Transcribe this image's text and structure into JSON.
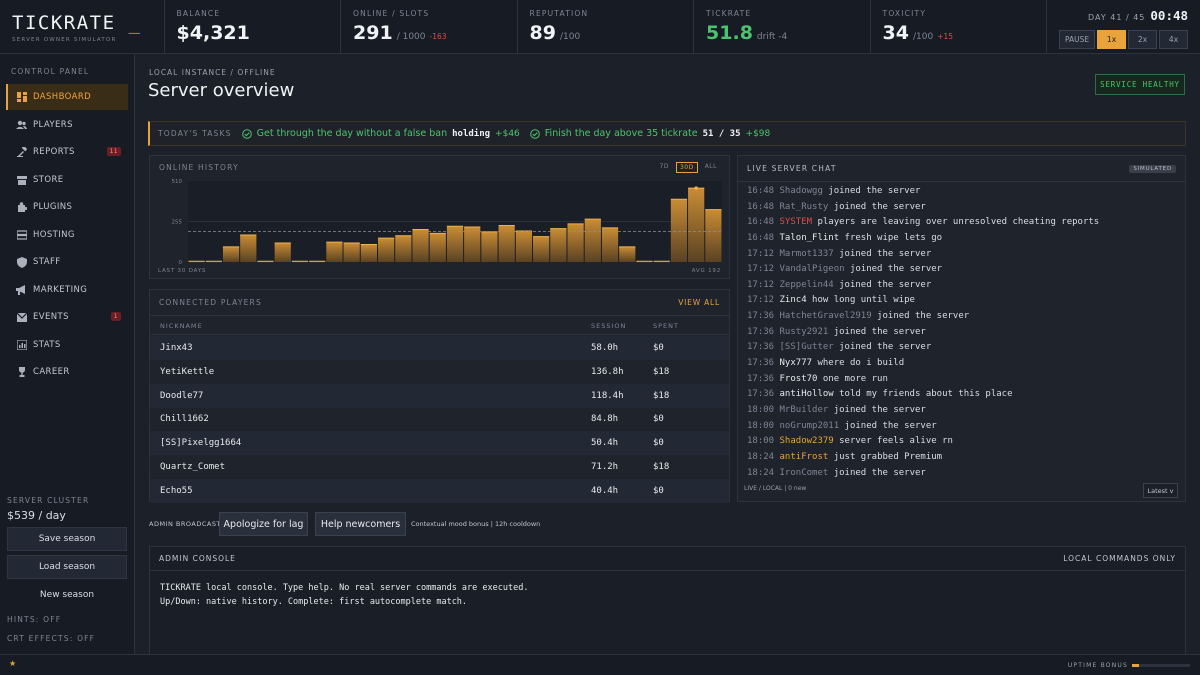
{
  "brand": {
    "name": "TICKRATE",
    "cursor": "_",
    "subtitle": "SERVER OWNER SIMULATOR"
  },
  "stats": {
    "balance": {
      "label": "BALANCE",
      "value": "$4,321"
    },
    "online": {
      "label": "ONLINE / SLOTS",
      "value": "291",
      "slots": "/ 1000",
      "delta": "-163"
    },
    "reputation": {
      "label": "REPUTATION",
      "value": "89",
      "max": "/100"
    },
    "tickrate": {
      "label": "TICKRATE",
      "value": "51.8",
      "drift": "drift -4"
    },
    "toxicity": {
      "label": "TOXICITY",
      "value": "34",
      "max": "/100",
      "delta": "+15"
    }
  },
  "time": {
    "day": "DAY 41 / 45",
    "clock": "00:48"
  },
  "speeds": [
    {
      "label": "PAUSE",
      "active": false
    },
    {
      "label": "1x",
      "active": true
    },
    {
      "label": "2x",
      "active": false
    },
    {
      "label": "4x",
      "active": false
    }
  ],
  "sidebar": {
    "section": "CONTROL PANEL",
    "items": [
      {
        "label": "DASHBOARD",
        "icon": "dashboard-icon",
        "active": true,
        "badge": ""
      },
      {
        "label": "PLAYERS",
        "icon": "players-icon",
        "active": false,
        "badge": ""
      },
      {
        "label": "REPORTS",
        "icon": "reports-icon",
        "active": false,
        "badge": "11"
      },
      {
        "label": "STORE",
        "icon": "store-icon",
        "active": false,
        "badge": ""
      },
      {
        "label": "PLUGINS",
        "icon": "plugins-icon",
        "active": false,
        "badge": ""
      },
      {
        "label": "HOSTING",
        "icon": "hosting-icon",
        "active": false,
        "badge": ""
      },
      {
        "label": "STAFF",
        "icon": "staff-icon",
        "active": false,
        "badge": ""
      },
      {
        "label": "MARKETING",
        "icon": "marketing-icon",
        "active": false,
        "badge": ""
      },
      {
        "label": "EVENTS",
        "icon": "events-icon",
        "active": false,
        "badge": "1"
      },
      {
        "label": "STATS",
        "icon": "stats-icon",
        "active": false,
        "badge": ""
      },
      {
        "label": "CAREER",
        "icon": "career-icon",
        "active": false,
        "badge": ""
      }
    ],
    "cluster": {
      "label": "SERVER CLUSTER",
      "price": "$539 / day",
      "save": "Save season",
      "load": "Load season",
      "new": "New season"
    },
    "hints": "HINTS: OFF",
    "crt": "CRT EFFECTS: OFF"
  },
  "main": {
    "crumb": "LOCAL INSTANCE / OFFLINE",
    "title": "Server overview",
    "health": "SERVICE HEALTHY"
  },
  "tasks": {
    "label": "TODAY'S TASKS",
    "items": [
      {
        "text": "Get through the day without a false ban",
        "status": "holding",
        "reward": "+$46"
      },
      {
        "text": "Finish the day above 35 tickrate",
        "status": "51 / 35",
        "reward": "+$98"
      }
    ]
  },
  "history": {
    "title": "ONLINE HISTORY",
    "ranges": [
      {
        "label": "7D",
        "active": false
      },
      {
        "label": "30D",
        "active": true
      },
      {
        "label": "ALL",
        "active": false
      }
    ],
    "foot_left": "LAST 30 DAYS",
    "foot_right": "AVG 192"
  },
  "chart_data": {
    "type": "bar",
    "ylim": [
      0,
      510
    ],
    "yticks": [
      "510",
      "255",
      "0"
    ],
    "values": [
      5,
      5,
      95,
      170,
      5,
      120,
      5,
      5,
      125,
      120,
      110,
      150,
      165,
      205,
      180,
      225,
      220,
      190,
      230,
      195,
      160,
      210,
      240,
      270,
      215,
      95,
      5,
      5,
      395,
      465,
      330
    ],
    "avg": 192,
    "marked_index": 29
  },
  "players": {
    "title": "CONNECTED PLAYERS",
    "view_all": "VIEW ALL",
    "columns": [
      "NICKNAME",
      "SESSION",
      "SPENT"
    ],
    "rows": [
      {
        "nick": "Jinx43",
        "session": "58.0h",
        "spent": "$0"
      },
      {
        "nick": "YetiKettle",
        "session": "136.8h",
        "spent": "$18"
      },
      {
        "nick": "Doodle77",
        "session": "118.4h",
        "spent": "$18"
      },
      {
        "nick": "Chill1662",
        "session": "84.8h",
        "spent": "$0"
      },
      {
        "nick": "[SS]Pixelgg1664",
        "session": "50.4h",
        "spent": "$0"
      },
      {
        "nick": "Quartz_Comet",
        "session": "71.2h",
        "spent": "$18"
      },
      {
        "nick": "Echo55",
        "session": "40.4h",
        "spent": "$0"
      }
    ]
  },
  "chat": {
    "title": "LIVE SERVER CHAT",
    "badge": "SIMULATED",
    "footer": "LIVE / LOCAL | 0 new",
    "latest": "Latest v",
    "lines": [
      {
        "time": "16:48",
        "user": "Shadowgg",
        "msg": "joined the server",
        "style": ""
      },
      {
        "time": "16:48",
        "user": "Rat_Rusty",
        "msg": "joined the server",
        "style": ""
      },
      {
        "time": "16:48",
        "user": "SYSTEM",
        "msg": "players are leaving over unresolved cheating reports",
        "style": "sys"
      },
      {
        "time": "16:48",
        "user": "Talon_Flint",
        "msg": "fresh wipe lets go",
        "style": "bright"
      },
      {
        "time": "17:12",
        "user": "Marmot1337",
        "msg": "joined the server",
        "style": ""
      },
      {
        "time": "17:12",
        "user": "VandalPigeon",
        "msg": "joined the server",
        "style": ""
      },
      {
        "time": "17:12",
        "user": "Zeppelin44",
        "msg": "joined the server",
        "style": ""
      },
      {
        "time": "17:12",
        "user": "Zinc4",
        "msg": "how long until wipe",
        "style": "bright"
      },
      {
        "time": "17:36",
        "user": "HatchetGravel2919",
        "msg": "joined the server",
        "style": ""
      },
      {
        "time": "17:36",
        "user": "Rusty2921",
        "msg": "joined the server",
        "style": ""
      },
      {
        "time": "17:36",
        "user": "[SS]Gutter",
        "msg": "joined the server",
        "style": ""
      },
      {
        "time": "17:36",
        "user": "Nyx777",
        "msg": "where do i build",
        "style": "bright"
      },
      {
        "time": "17:36",
        "user": "Frost70",
        "msg": "one more run",
        "style": "bright"
      },
      {
        "time": "17:36",
        "user": "antiHollow",
        "msg": "told my friends about this place",
        "style": "bright"
      },
      {
        "time": "18:00",
        "user": "MrBuilder",
        "msg": "joined the server",
        "style": ""
      },
      {
        "time": "18:00",
        "user": "noGrump2011",
        "msg": "joined the server",
        "style": ""
      },
      {
        "time": "18:00",
        "user": "Shadow2379",
        "msg": "server feels alive rn",
        "style": "gold"
      },
      {
        "time": "18:24",
        "user": "antiFrost",
        "msg": "just grabbed Premium",
        "style": "gold"
      },
      {
        "time": "18:24",
        "user": "IronComet",
        "msg": "joined the server",
        "style": ""
      }
    ]
  },
  "broadcast": {
    "label": "ADMIN BROADCAST",
    "buttons": [
      "Apologize for lag",
      "Help newcomers"
    ],
    "note": "Contextual mood bonus | 12h cooldown"
  },
  "console": {
    "title": "ADMIN CONSOLE",
    "mode": "LOCAL COMMANDS ONLY",
    "lines": [
      "TICKRATE local console. Type help. No real server commands are executed.",
      "Up/Down: native history. Complete: first autocomplete match."
    ]
  },
  "statusbar": {
    "star": "★",
    "uptime": "UPTIME BONUS",
    "uptime_fraction": 0.12
  },
  "colors": {
    "accent": "#e8a33a",
    "good": "#4cc46e",
    "bad": "#e04b4b",
    "bg": "#1b2029"
  }
}
